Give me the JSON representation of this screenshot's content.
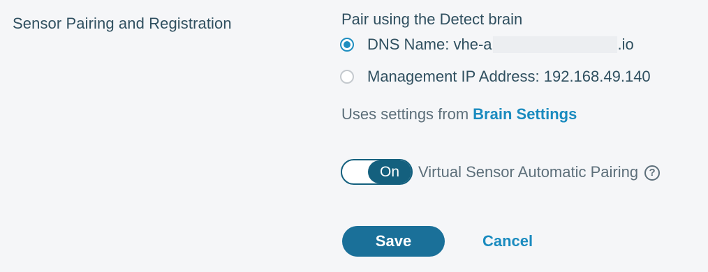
{
  "section": {
    "label": "Sensor Pairing and Registration"
  },
  "pairing": {
    "title": "Pair using the Detect brain",
    "options": [
      {
        "prefix": "DNS Name: vhe-a",
        "suffix": ".io",
        "selected": true
      },
      {
        "label": "Management IP Address: 192.168.49.140",
        "selected": false
      }
    ],
    "uses_settings_text": "Uses settings from",
    "brain_settings_link": "Brain Settings"
  },
  "auto_pairing": {
    "toggle_state": "On",
    "label": "Virtual Sensor Automatic Pairing",
    "help_icon": "?"
  },
  "actions": {
    "save_label": "Save",
    "cancel_label": "Cancel"
  },
  "colors": {
    "accent": "#1a8bbf",
    "toggle_on": "#14607e",
    "save_button": "#1a7099",
    "background": "#f5f6f8"
  }
}
